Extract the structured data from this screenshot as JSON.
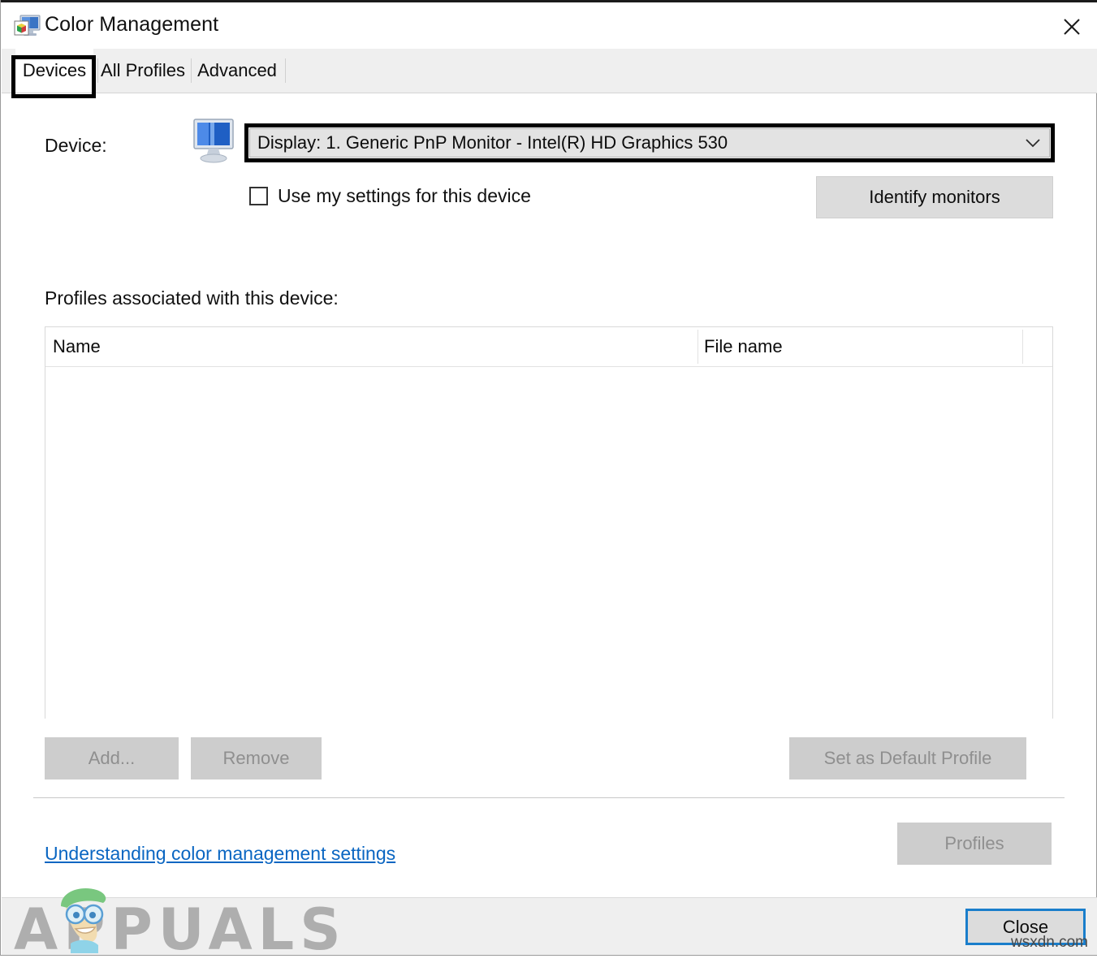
{
  "window": {
    "title": "Color Management",
    "icon": "color-management-icon",
    "close_icon": "close-icon"
  },
  "tabs": [
    {
      "label": "Devices",
      "active": true
    },
    {
      "label": "All Profiles",
      "active": false
    },
    {
      "label": "Advanced",
      "active": false
    }
  ],
  "device_section": {
    "label": "Device:",
    "icon": "monitor-icon",
    "selected_device": "Display: 1. Generic PnP Monitor - Intel(R) HD Graphics 530",
    "dropdown_arrow_icon": "chevron-down-icon",
    "checkbox": {
      "label": "Use my settings for this device",
      "checked": false
    },
    "identify_monitors_label": "Identify monitors"
  },
  "profiles_section": {
    "label": "Profiles associated with this device:",
    "columns": [
      "Name",
      "File name"
    ],
    "rows": [],
    "add_label": "Add...",
    "remove_label": "Remove",
    "set_default_label": "Set as Default Profile"
  },
  "footer_links": {
    "help_link": "Understanding color management settings",
    "profiles_label": "Profiles"
  },
  "footer": {
    "close_label": "Close"
  },
  "watermarks": {
    "brand": "APPUALS",
    "source": "wsxdn.com"
  },
  "colors": {
    "accent_link": "#0a66c2",
    "focus_border": "#1a7ecb",
    "tabstrip_bg": "#efefef",
    "button_bg": "#dcdcdc",
    "button_disabled_bg": "#cdcdcd",
    "annotation": "#000000"
  }
}
